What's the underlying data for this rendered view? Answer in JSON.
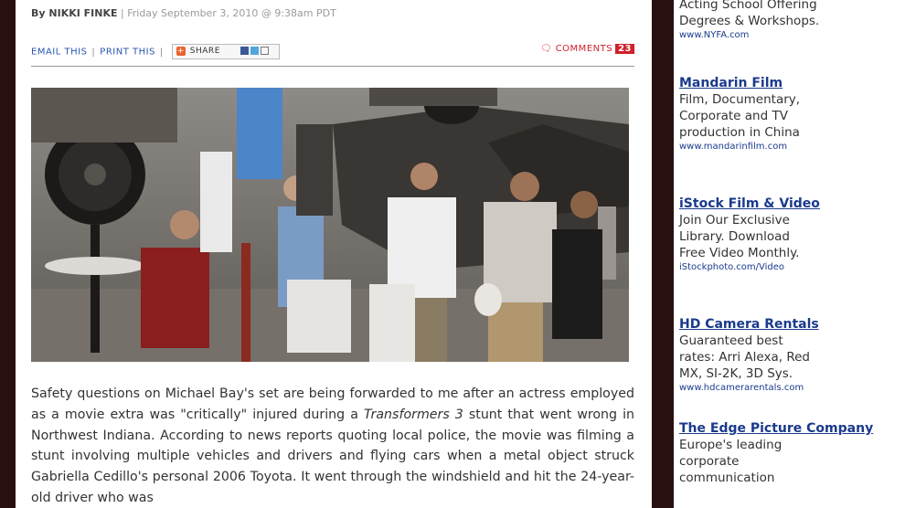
{
  "byline": {
    "prefix": "By ",
    "author": "NIKKI FINKE",
    "date": " | Friday September 3, 2010 @ 9:38am PDT"
  },
  "tools": {
    "email": "EMAIL THIS",
    "print": "PRINT THIS",
    "share": "SHARE",
    "comments_label": "COMMENTS",
    "comments_count": "23"
  },
  "article": {
    "p1_a": "Safety questions on Michael Bay's set are being forwarded to me after an actress employed as a movie extra was \"critically\" injured during a ",
    "p1_em": "Transformers 3",
    "p1_b": " stunt that went wrong in Northwest Indiana. According to news reports quoting local police, the movie was filming a stunt involving multiple vehicles and drivers and flying cars when a metal object struck Gabriella Cedillo's personal 2006 Toyota. It went through the windshield and hit the 24-year-old driver who was"
  },
  "sidebar": {
    "ads": [
      {
        "title": "",
        "lines": [
          "Acting School Offering",
          "Degrees & Workshops."
        ],
        "url": "www.NYFA.com"
      },
      {
        "title": "Mandarin Film",
        "lines": [
          "Film, Documentary,",
          "Corporate and TV",
          "production in China"
        ],
        "url": "www.mandarinfilm.com"
      },
      {
        "title": "iStock Film & Video",
        "lines": [
          "Join Our Exclusive",
          "Library. Download",
          "Free Video Monthly."
        ],
        "url": "iStockphoto.com/Video"
      },
      {
        "title": "HD Camera Rentals",
        "lines": [
          "Guaranteed best",
          "rates: Arri Alexa, Red",
          "MX, SI-2K, 3D Sys."
        ],
        "url": "www.hdcamerarentals.com"
      },
      {
        "title": "The Edge Picture Company",
        "lines": [
          "Europe's leading",
          "corporate",
          "communication"
        ],
        "url": ""
      }
    ]
  },
  "colors": {
    "page_bg": "#2a0f10",
    "link": "#2a56b0",
    "comments_red": "#d0202a",
    "ad_title": "#1a3a8c"
  }
}
